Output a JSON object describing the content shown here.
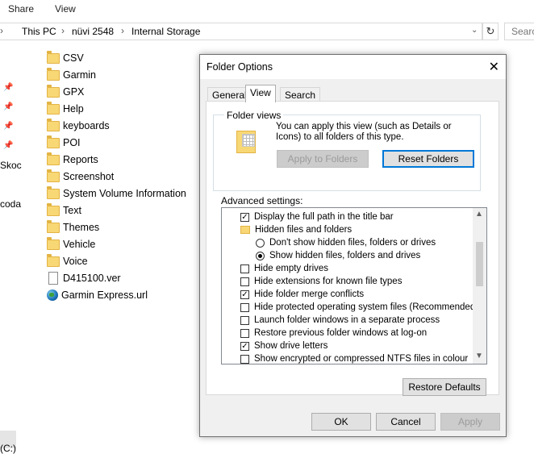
{
  "ribbon": {
    "tabs": [
      "Share",
      "View"
    ]
  },
  "address": {
    "crumbs": [
      "This PC",
      "nüvi 2548",
      "Internal Storage"
    ],
    "search_placeholder": "Search"
  },
  "nav_pane": {
    "cut_labels": [
      "Skoc",
      "coda",
      "(C:)"
    ]
  },
  "files": [
    {
      "name": "CSV",
      "type": "folder"
    },
    {
      "name": "Garmin",
      "type": "folder"
    },
    {
      "name": "GPX",
      "type": "folder"
    },
    {
      "name": "Help",
      "type": "folder"
    },
    {
      "name": "keyboards",
      "type": "folder"
    },
    {
      "name": "POI",
      "type": "folder"
    },
    {
      "name": "Reports",
      "type": "folder"
    },
    {
      "name": "Screenshot",
      "type": "folder"
    },
    {
      "name": "System Volume Information",
      "type": "folder"
    },
    {
      "name": "Text",
      "type": "folder"
    },
    {
      "name": "Themes",
      "type": "folder"
    },
    {
      "name": "Vehicle",
      "type": "folder"
    },
    {
      "name": "Voice",
      "type": "folder"
    },
    {
      "name": "D415100.ver",
      "type": "file"
    },
    {
      "name": "Garmin Express.url",
      "type": "url"
    }
  ],
  "dialog": {
    "title": "Folder Options",
    "tabs": [
      "General",
      "View",
      "Search"
    ],
    "active_tab": "View",
    "folder_views": {
      "label": "Folder views",
      "text": "You can apply this view (such as Details or Icons) to all folders of this type.",
      "apply_button": "Apply to Folders",
      "reset_button": "Reset Folders"
    },
    "advanced_label": "Advanced settings:",
    "advanced_items": [
      {
        "kind": "checkbox",
        "checked": true,
        "label": "Display the full path in the title bar"
      },
      {
        "kind": "folder",
        "label": "Hidden files and folders"
      },
      {
        "kind": "radio",
        "checked": false,
        "label": "Don't show hidden files, folders or drives"
      },
      {
        "kind": "radio",
        "checked": true,
        "label": "Show hidden files, folders and drives"
      },
      {
        "kind": "checkbox",
        "checked": false,
        "label": "Hide empty drives"
      },
      {
        "kind": "checkbox",
        "checked": false,
        "label": "Hide extensions for known file types"
      },
      {
        "kind": "checkbox",
        "checked": true,
        "label": "Hide folder merge conflicts"
      },
      {
        "kind": "checkbox",
        "checked": false,
        "label": "Hide protected operating system files (Recommended)"
      },
      {
        "kind": "checkbox",
        "checked": false,
        "label": "Launch folder windows in a separate process"
      },
      {
        "kind": "checkbox",
        "checked": false,
        "label": "Restore previous folder windows at log-on"
      },
      {
        "kind": "checkbox",
        "checked": true,
        "label": "Show drive letters"
      },
      {
        "kind": "checkbox",
        "checked": false,
        "label": "Show encrypted or compressed NTFS files in colour"
      }
    ],
    "restore_defaults": "Restore Defaults",
    "ok": "OK",
    "cancel": "Cancel",
    "apply": "Apply"
  },
  "colors": {
    "focus_border": "#0078d7",
    "folder": "#f8d775"
  }
}
